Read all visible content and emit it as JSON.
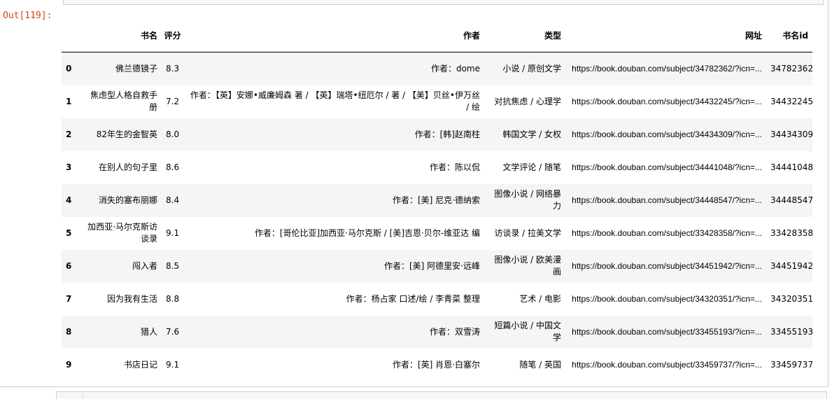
{
  "prompt": "Out[119]:",
  "table": {
    "columns": [
      "书名",
      "评分",
      "作者",
      "类型",
      "网址",
      "书名id"
    ],
    "rows": [
      {
        "idx": "0",
        "name": "佛兰德镜子",
        "score": "8.3",
        "author": "作者：dome",
        "type": "小说 / 原创文学",
        "url": "https://book.douban.com/subject/34782362/?icn=...",
        "id": "34782362"
      },
      {
        "idx": "1",
        "name": "焦虑型人格自救手册",
        "score": "7.2",
        "author": "作者：【英】安娜•威廉姆森 著 / 【英】瑞塔•纽厄尔 / 著 / 【美】贝丝•伊万丝 / 绘",
        "type": "对抗焦虑 / 心理学",
        "url": "https://book.douban.com/subject/34432245/?icn=...",
        "id": "34432245"
      },
      {
        "idx": "2",
        "name": "82年生的金智英",
        "score": "8.0",
        "author": "作者：[韩]赵南柱",
        "type": "韩国文学 / 女权",
        "url": "https://book.douban.com/subject/34434309/?icn=...",
        "id": "34434309"
      },
      {
        "idx": "3",
        "name": "在别人的句子里",
        "score": "8.6",
        "author": "作者：陈以侃",
        "type": "文学评论 / 随笔",
        "url": "https://book.douban.com/subject/34441048/?icn=...",
        "id": "34441048"
      },
      {
        "idx": "4",
        "name": "消失的塞布丽娜",
        "score": "8.4",
        "author": "作者：[美] 尼克·德纳索",
        "type": "图像小说 / 网络暴力",
        "url": "https://book.douban.com/subject/34448547/?icn=...",
        "id": "34448547"
      },
      {
        "idx": "5",
        "name": "加西亚·马尔克斯访谈录",
        "score": "9.1",
        "author": "作者：[哥伦比亚]加西亚·马尔克斯 / [美]吉恩·贝尔-维亚达 编",
        "type": "访谈录 / 拉美文学",
        "url": "https://book.douban.com/subject/33428358/?icn=...",
        "id": "33428358"
      },
      {
        "idx": "6",
        "name": "闯入者",
        "score": "8.5",
        "author": "作者：[美] 阿德里安·远峰",
        "type": "图像小说 / 欧美漫画",
        "url": "https://book.douban.com/subject/34451942/?icn=...",
        "id": "34451942"
      },
      {
        "idx": "7",
        "name": "因为我有生活",
        "score": "8.8",
        "author": "作者：杨占家 口述/绘 / 李青菜 整理",
        "type": "艺术 / 电影",
        "url": "https://book.douban.com/subject/34320351/?icn=...",
        "id": "34320351"
      },
      {
        "idx": "8",
        "name": "猎人",
        "score": "7.6",
        "author": "作者：双雪涛",
        "type": "短篇小说 / 中国文学",
        "url": "https://book.douban.com/subject/33455193/?icn=...",
        "id": "33455193"
      },
      {
        "idx": "9",
        "name": "书店日记",
        "score": "9.1",
        "author": "作者：[英] 肖恩·白塞尔",
        "type": "随笔 / 英国",
        "url": "https://book.douban.com/subject/33459737/?icn=...",
        "id": "33459737"
      }
    ]
  }
}
